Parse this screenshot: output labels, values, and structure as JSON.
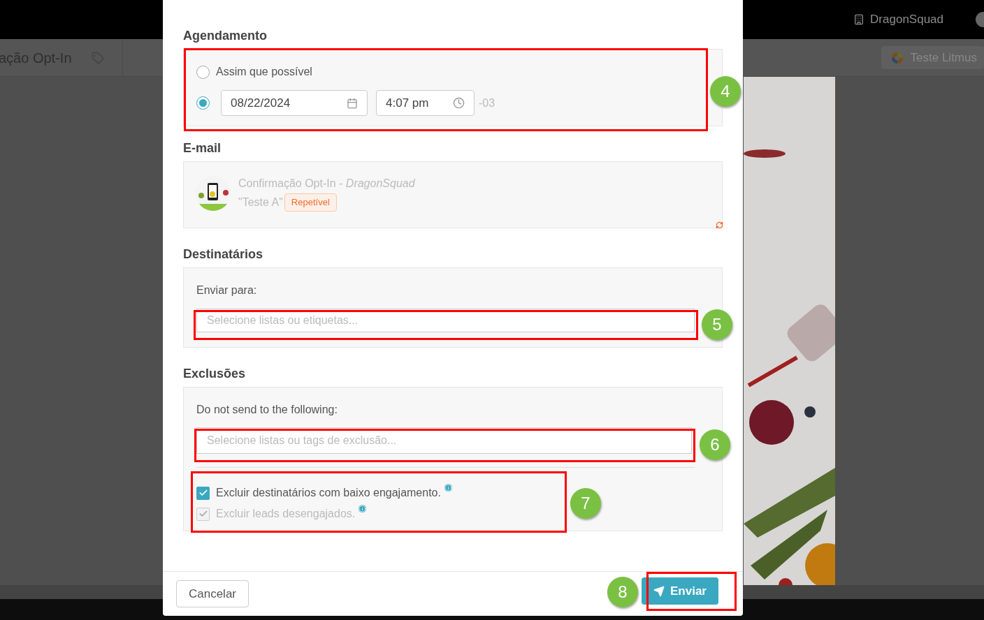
{
  "background": {
    "page_title": "ação Opt-In",
    "account": "DragonSquad",
    "litmus_button": "Teste Litmus"
  },
  "modal": {
    "scheduling": {
      "title": "Agendamento",
      "options": [
        {
          "kind": "asap",
          "label": "Assim que possível",
          "selected": false
        },
        {
          "kind": "datetime",
          "selected": true,
          "date": "08/22/2024",
          "time": "4:07 pm",
          "timezone": "-03"
        }
      ]
    },
    "email": {
      "title": "E-mail",
      "name": "Confirmação Opt-In - *DragonSquad*",
      "variant": "\"Teste A\"",
      "badge": "Repetível"
    },
    "recipients": {
      "title": "Destinatários",
      "label": "Enviar para:",
      "placeholder": "Selecione listas ou etiquetas..."
    },
    "exclusions": {
      "title": "Exclusões",
      "label": "Do not send to the following:",
      "placeholder": "Selecione listas ou tags de exclusão...",
      "options": [
        {
          "label": "Excluir destinatários com baixo engajamento.",
          "checked": true,
          "disabled": false
        },
        {
          "label": "Excluir leads desengajados.",
          "checked": true,
          "disabled": true
        }
      ]
    },
    "footer": {
      "cancel": "Cancelar",
      "send": "Enviar"
    }
  },
  "annotations": [
    {
      "label": "4"
    },
    {
      "label": "5"
    },
    {
      "label": "6"
    },
    {
      "label": "7"
    },
    {
      "label": "8"
    }
  ]
}
